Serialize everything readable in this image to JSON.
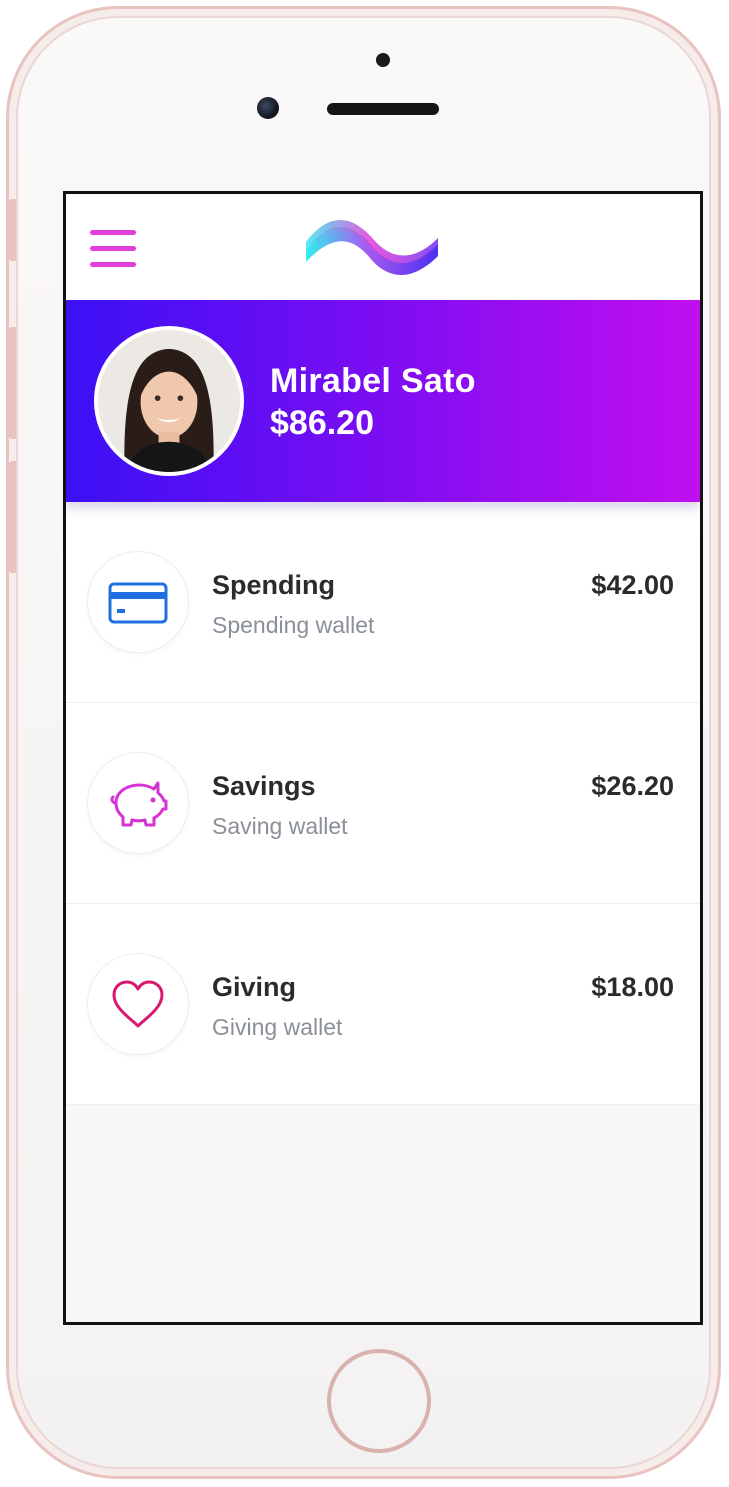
{
  "colors": {
    "accent": "#e23ed9",
    "header_gradient_start": "#3b10f5",
    "header_gradient_end": "#c10ff0",
    "text_dark": "#2b2b2b",
    "text_muted": "#8a8f99",
    "card_icon": "#1f6fe0",
    "piggy_icon": "#d633d6",
    "heart_icon": "#d9186f"
  },
  "header": {
    "menu_icon": "hamburger-menu-icon",
    "logo": "wave-logo"
  },
  "profile": {
    "name": "Mirabel Sato",
    "balance": "$86.20",
    "avatar": "profile-photo"
  },
  "wallets": [
    {
      "icon": "credit-card-icon",
      "title": "Spending",
      "subtitle": "Spending wallet",
      "amount": "$42.00"
    },
    {
      "icon": "piggy-bank-icon",
      "title": "Savings",
      "subtitle": "Saving wallet",
      "amount": "$26.20"
    },
    {
      "icon": "heart-icon",
      "title": "Giving",
      "subtitle": "Giving wallet",
      "amount": "$18.00"
    }
  ]
}
